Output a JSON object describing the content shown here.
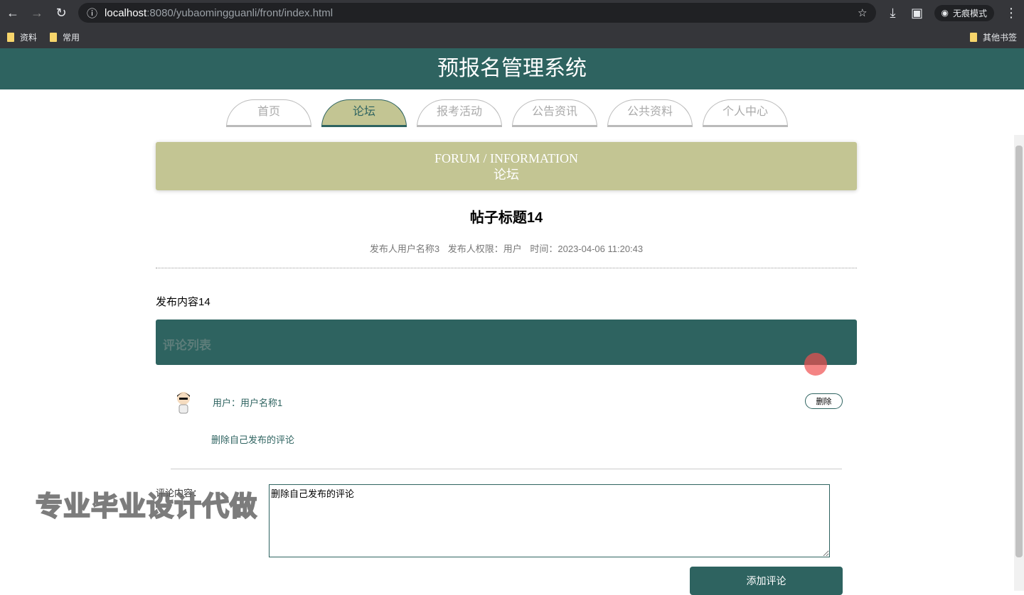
{
  "browser": {
    "url_host": "localhost",
    "url_rest": ":8080/yubaomingguanli/front/index.html",
    "incognito": "无痕模式",
    "bookmarks": [
      "资料",
      "常用"
    ],
    "other_bookmarks": "其他书签"
  },
  "header": {
    "title": "预报名管理系统"
  },
  "tabs": [
    "首页",
    "论坛",
    "报考活动",
    "公告资讯",
    "公共资料",
    "个人中心"
  ],
  "banner": {
    "en": "FORUM / INFORMATION",
    "cn": "论坛"
  },
  "post": {
    "title": "帖子标题14",
    "author": "发布人用户名称3",
    "role": "发布人权限：用户",
    "time": "时间：2023-04-06 11:20:43",
    "content": "发布内容14"
  },
  "comments": {
    "header": "评论列表",
    "items": [
      {
        "user": "用户：用户名称1",
        "text": "删除自己发布的评论",
        "delete": "删除"
      }
    ]
  },
  "form": {
    "label": "评论内容：",
    "value": "删除自己发布的评论",
    "submit": "添加评论"
  },
  "watermark": "专业毕业设计代做"
}
